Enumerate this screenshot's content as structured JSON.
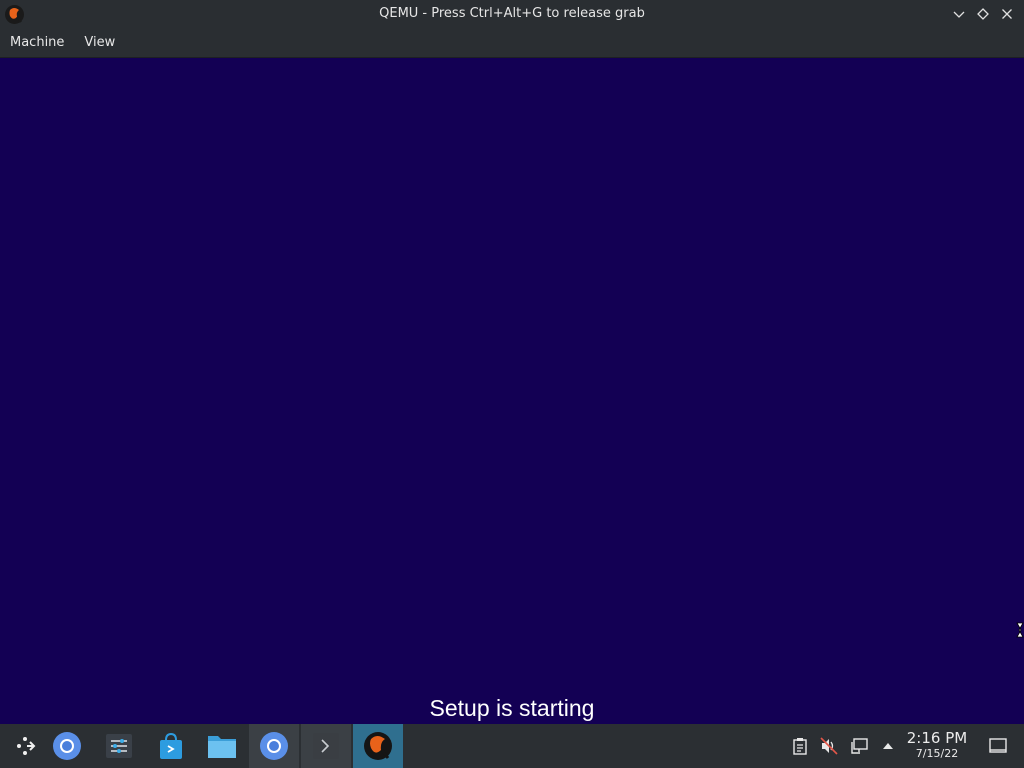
{
  "window": {
    "title": "QEMU - Press Ctrl+Alt+G to release grab",
    "app_icon": "qemu-icon",
    "controls": [
      "minimize-icon",
      "maximize-icon",
      "close-icon"
    ]
  },
  "menubar": {
    "items": [
      {
        "label": "Machine"
      },
      {
        "label": "View"
      }
    ]
  },
  "guest": {
    "status_text": "Setup is starting",
    "background_color": "#130054"
  },
  "taskbar": {
    "launchers": [
      {
        "icon": "app-launcher-icon"
      },
      {
        "icon": "chromium-icon"
      },
      {
        "icon": "system-settings-icon"
      },
      {
        "icon": "discover-store-icon"
      },
      {
        "icon": "file-manager-icon"
      },
      {
        "icon": "chromium-icon"
      },
      {
        "icon": "terminal-icon"
      },
      {
        "icon": "qemu-icon"
      }
    ],
    "tray": [
      {
        "icon": "clipboard-icon"
      },
      {
        "icon": "volume-muted-icon"
      },
      {
        "icon": "network-icon"
      },
      {
        "icon": "expand-tray-icon"
      }
    ],
    "clock": {
      "time": "2:16 PM",
      "date": "7/15/22"
    },
    "show_desktop_icon": "show-desktop-icon"
  }
}
